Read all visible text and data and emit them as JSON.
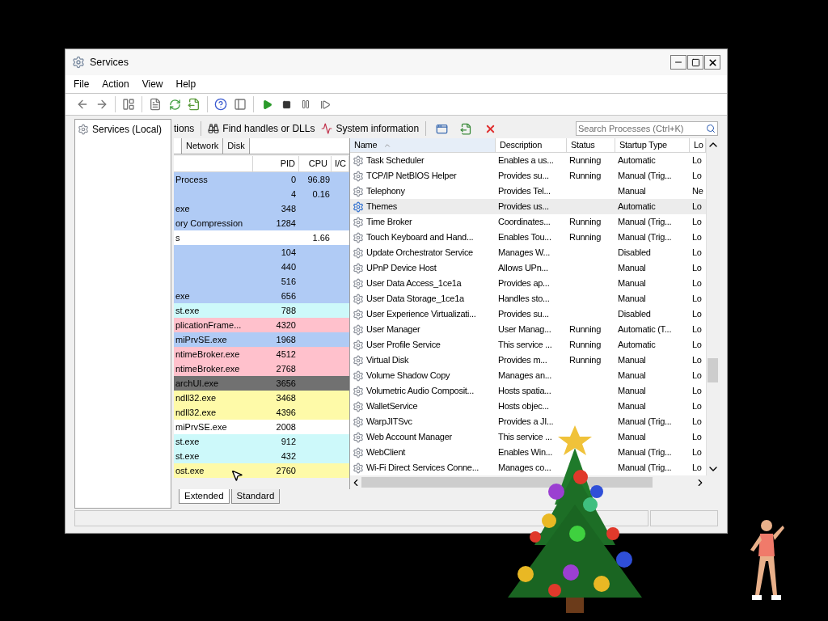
{
  "window": {
    "title": "Services"
  },
  "menu": [
    {
      "label": "File"
    },
    {
      "label": "Action"
    },
    {
      "label": "View"
    },
    {
      "label": "Help"
    }
  ],
  "tree": [
    {
      "label": "Services (Local)"
    }
  ],
  "process_panel": {
    "toolbar_items": [
      {
        "kind": "text",
        "label": "tions"
      },
      {
        "kind": "binoculars",
        "label": "Find handles or DLLs"
      },
      {
        "kind": "chart",
        "label": "System information"
      }
    ],
    "search": {
      "placeholder": "Search Processes (Ctrl+K)"
    },
    "tabs": [
      {
        "label": "Network",
        "selected": false
      },
      {
        "label": "Disk",
        "selected": false
      }
    ],
    "columns": [
      "PID",
      "CPU",
      "I/C"
    ],
    "rows": [
      {
        "name": "Process",
        "pid": "0",
        "cpu": "96.89",
        "color": "#b0cbf5"
      },
      {
        "pid": "4",
        "cpu": "0.16",
        "color": "#b0cbf5"
      },
      {
        "name": "exe",
        "pid": "348",
        "color": "#b0cbf5"
      },
      {
        "name": "ory Compression",
        "pid": "1284",
        "color": "#b0cbf5"
      },
      {
        "name": "s",
        "cpu": "1.66",
        "color": "#ffffff"
      },
      {
        "pid": "104",
        "color": "#b0cbf5"
      },
      {
        "pid": "440",
        "color": "#b0cbf5"
      },
      {
        "pid": "516",
        "color": "#b0cbf5"
      },
      {
        "name": "exe",
        "pid": "656",
        "color": "#b0cbf5"
      },
      {
        "name": "st.exe",
        "pid": "788",
        "color": "#cdf9fa"
      },
      {
        "name": "plicationFrame...",
        "pid": "4320",
        "color": "#ffc1cc"
      },
      {
        "name": "miPrvSE.exe",
        "pid": "1968",
        "color": "#b0cbf5"
      },
      {
        "name": "ntimeBroker.exe",
        "pid": "4512",
        "color": "#ffc1cc"
      },
      {
        "name": "ntimeBroker.exe",
        "pid": "2768",
        "color": "#ffc1cc"
      },
      {
        "name": "archUI.exe",
        "pid": "3656",
        "color": "#717171"
      },
      {
        "name": "ndll32.exe",
        "pid": "3468",
        "color": "#fefaa8"
      },
      {
        "name": "ndll32.exe",
        "pid": "4396",
        "color": "#fefaa8"
      },
      {
        "name": "miPrvSE.exe",
        "pid": "2008",
        "color": "#ffffff"
      },
      {
        "name": "st.exe",
        "pid": "912",
        "color": "#cdf9fa"
      },
      {
        "name": "st.exe",
        "pid": "432",
        "color": "#cdf9fa"
      },
      {
        "name": "ost.exe",
        "pid": "2760",
        "color": "#fefaa8"
      }
    ],
    "bottom_tabs": [
      {
        "label": "Extended",
        "selected": true
      },
      {
        "label": "Standard",
        "selected": false
      }
    ]
  },
  "services": {
    "columns": [
      {
        "label": "Name",
        "sorted": true
      },
      {
        "label": "Description",
        "sorted": false
      },
      {
        "label": "Status",
        "sorted": false
      },
      {
        "label": "Startup Type",
        "sorted": false
      },
      {
        "label": "Lo",
        "sorted": false
      }
    ],
    "rows": [
      {
        "name": "Task Scheduler",
        "description": "Enables a us...",
        "status": "Running",
        "startup": "Automatic",
        "logon": "Lo",
        "selected": false
      },
      {
        "name": "TCP/IP NetBIOS Helper",
        "description": "Provides su...",
        "status": "Running",
        "startup": "Manual (Trig...",
        "logon": "Lo",
        "selected": false
      },
      {
        "name": "Telephony",
        "description": "Provides Tel...",
        "startup": "Manual",
        "logon": "Ne",
        "selected": false
      },
      {
        "name": "Themes",
        "description": "Provides us...",
        "startup": "Automatic",
        "logon": "Lo",
        "selected": true
      },
      {
        "name": "Time Broker",
        "description": "Coordinates...",
        "status": "Running",
        "startup": "Manual (Trig...",
        "logon": "Lo",
        "selected": false
      },
      {
        "name": "Touch Keyboard and Hand...",
        "description": "Enables Tou...",
        "status": "Running",
        "startup": "Manual (Trig...",
        "logon": "Lo",
        "selected": false
      },
      {
        "name": "Update Orchestrator Service",
        "description": "Manages W...",
        "startup": "Disabled",
        "logon": "Lo",
        "selected": false
      },
      {
        "name": "UPnP Device Host",
        "description": "Allows UPn...",
        "startup": "Manual",
        "logon": "Lo",
        "selected": false
      },
      {
        "name": "User Data Access_1ce1a",
        "description": "Provides ap...",
        "startup": "Manual",
        "logon": "Lo",
        "selected": false
      },
      {
        "name": "User Data Storage_1ce1a",
        "description": "Handles sto...",
        "startup": "Manual",
        "logon": "Lo",
        "selected": false
      },
      {
        "name": "User Experience Virtualizati...",
        "description": "Provides su...",
        "startup": "Disabled",
        "logon": "Lo",
        "selected": false
      },
      {
        "name": "User Manager",
        "description": "User Manag...",
        "status": "Running",
        "startup": "Automatic (T...",
        "logon": "Lo",
        "selected": false
      },
      {
        "name": "User Profile Service",
        "description": "This service ...",
        "status": "Running",
        "startup": "Automatic",
        "logon": "Lo",
        "selected": false
      },
      {
        "name": "Virtual Disk",
        "description": "Provides m...",
        "status": "Running",
        "startup": "Manual",
        "logon": "Lo",
        "selected": false
      },
      {
        "name": "Volume Shadow Copy",
        "description": "Manages an...",
        "startup": "Manual",
        "logon": "Lo",
        "selected": false
      },
      {
        "name": "Volumetric Audio Composit...",
        "description": "Hosts spatia...",
        "startup": "Manual",
        "logon": "Lo",
        "selected": false
      },
      {
        "name": "WalletService",
        "description": "Hosts objec...",
        "startup": "Manual",
        "logon": "Lo",
        "selected": false
      },
      {
        "name": "WarpJITSvc",
        "description": "Provides a JI...",
        "startup": "Manual (Trig...",
        "logon": "Lo",
        "selected": false
      },
      {
        "name": "Web Account Manager",
        "description": "This service ...",
        "startup": "Manual",
        "logon": "Lo",
        "selected": false
      },
      {
        "name": "WebClient",
        "description": "Enables Win...",
        "startup": "Manual (Trig...",
        "logon": "Lo",
        "selected": false
      },
      {
        "name": "Wi-Fi Direct Services Conne...",
        "description": "Manages co...",
        "startup": "Manual (Trig...",
        "logon": "Lo",
        "selected": false
      }
    ]
  }
}
